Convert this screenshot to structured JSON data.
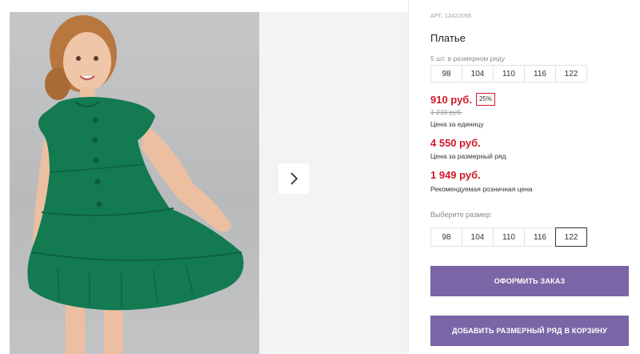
{
  "product": {
    "sku": "АРТ. 12422055",
    "title": "Платье",
    "pack_note": "5 шт. в размерном ряду",
    "pack_sizes": [
      "98",
      "104",
      "110",
      "116",
      "122"
    ]
  },
  "pricing": {
    "unit_price": "910 руб.",
    "discount": "25%",
    "old_price": "1 210 руб.",
    "unit_caption": "Цена за единицу",
    "pack_price": "4 550 руб.",
    "pack_caption": "Цена за размерный ряд",
    "retail_price": "1 949 руб.",
    "retail_caption": "Рекомендуемая розничная цена"
  },
  "size_selector": {
    "label": "Выберите размер:",
    "options": [
      "98",
      "104",
      "110",
      "116",
      "122"
    ],
    "selected": "122"
  },
  "actions": {
    "order_label": "ОФОРМИТЬ ЗАКАЗ",
    "add_pack_label": "ДОБАВИТЬ РАЗМЕРНЫЙ РЯД В КОРЗИНУ"
  },
  "colors": {
    "price_red": "#d11a2a",
    "button_purple": "#7a66a6",
    "dress_green": "#137a52"
  },
  "icons": {
    "next": "chevron-right-icon"
  }
}
